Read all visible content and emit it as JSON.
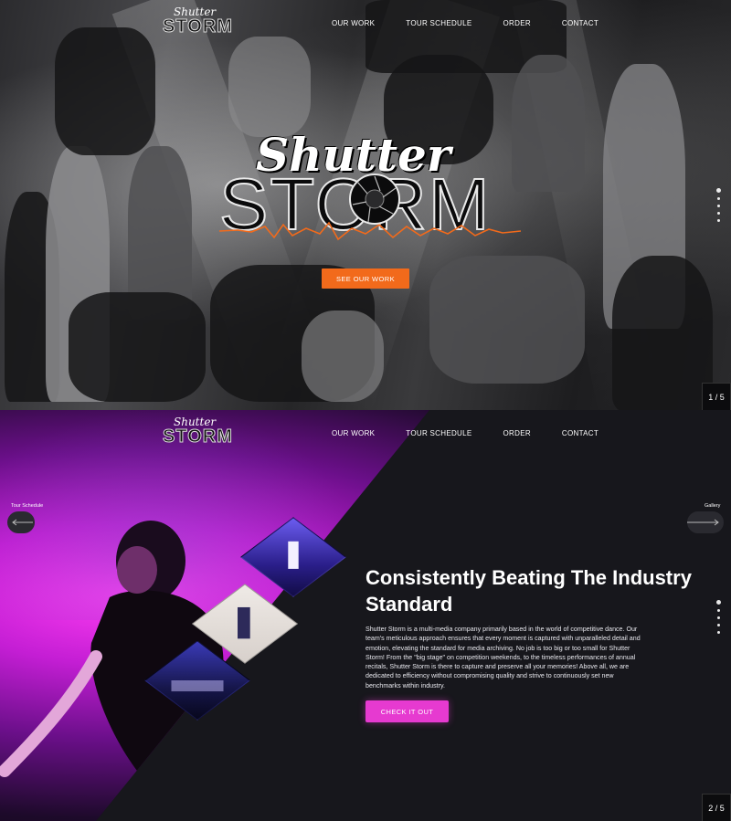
{
  "brand": {
    "logo_script": "Shutter",
    "logo_word": "STORM"
  },
  "nav": {
    "items": [
      "OUR WORK",
      "TOUR SCHEDULE",
      "ORDER",
      "CONTACT"
    ]
  },
  "hero": {
    "cta_label": "SEE OUR WORK",
    "pager": "1 / 5",
    "accent_color": "#f26a1b"
  },
  "section2": {
    "left_label": "Tour Schedule",
    "right_label": "Gallery",
    "headline": "Consistently Beating The Industry Standard",
    "paragraph": "Shutter Storm is a multi-media company primarily based in the world of competitive dance. Our team's meticulous approach ensures that every moment is captured with unparalleled detail and emotion, elevating the standard for media archiving. No job is too big or too small for Shutter Storm!  From the \"big stage\" on competition weekends, to the timeless performances of annual recitals, Shutter Storm is there to capture and preserve all your memories! Above all, we are dedicated to efficiency without compromising quality and strive to continuously set new benchmarks within industry.",
    "cta_label": "CHECK IT OUT",
    "pager": "2 / 5",
    "accent_color": "#e63ad0"
  },
  "icons": [
    "arrow-left-icon",
    "arrow-right-icon",
    "shutter-aperture-icon",
    "slide-dot-icon"
  ]
}
